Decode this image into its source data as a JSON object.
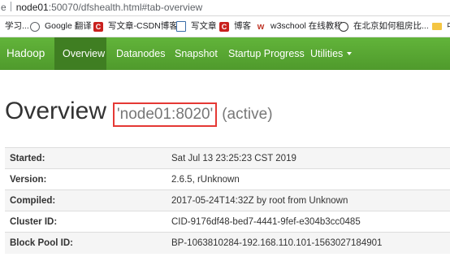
{
  "address_bar": {
    "prefix": "e",
    "host": "node01",
    "path": ":50070/dfshealth.html#tab-overview"
  },
  "bookmarks": [
    {
      "label": "学习...",
      "icon": "folder-icon"
    },
    {
      "label": "Google 翻译",
      "icon": "globe-icon"
    },
    {
      "label": "写文章-CSDN博客",
      "icon": "csdn-icon"
    },
    {
      "label": "写文章",
      "icon": "document-icon"
    },
    {
      "label": "博客",
      "icon": "csdn-icon"
    },
    {
      "label": "w3school 在线教程",
      "icon": "w3school-icon"
    },
    {
      "label": "在北京如何租房比...",
      "icon": "compass-icon"
    },
    {
      "label": "中",
      "icon": "folder-icon"
    }
  ],
  "navbar": {
    "brand": "Hadoop",
    "items": [
      "Overview",
      "Datanodes",
      "Snapshot",
      "Startup Progress",
      "Utilities"
    ],
    "active": "Overview",
    "color": "#5aa834"
  },
  "heading": {
    "title": "Overview",
    "node": "'node01:8020'",
    "status": "(active)",
    "highlight_color": "#e53935"
  },
  "info": [
    {
      "key": "Started:",
      "value": "Sat Jul 13 23:25:23 CST 2019"
    },
    {
      "key": "Version:",
      "value": "2.6.5, rUnknown"
    },
    {
      "key": "Compiled:",
      "value": "2017-05-24T14:32Z by root from Unknown"
    },
    {
      "key": "Cluster ID:",
      "value": "CID-9176df48-bed7-4441-9fef-e304b3cc0485"
    },
    {
      "key": "Block Pool ID:",
      "value": "BP-1063810284-192.168.110.101-1563027184901"
    }
  ]
}
